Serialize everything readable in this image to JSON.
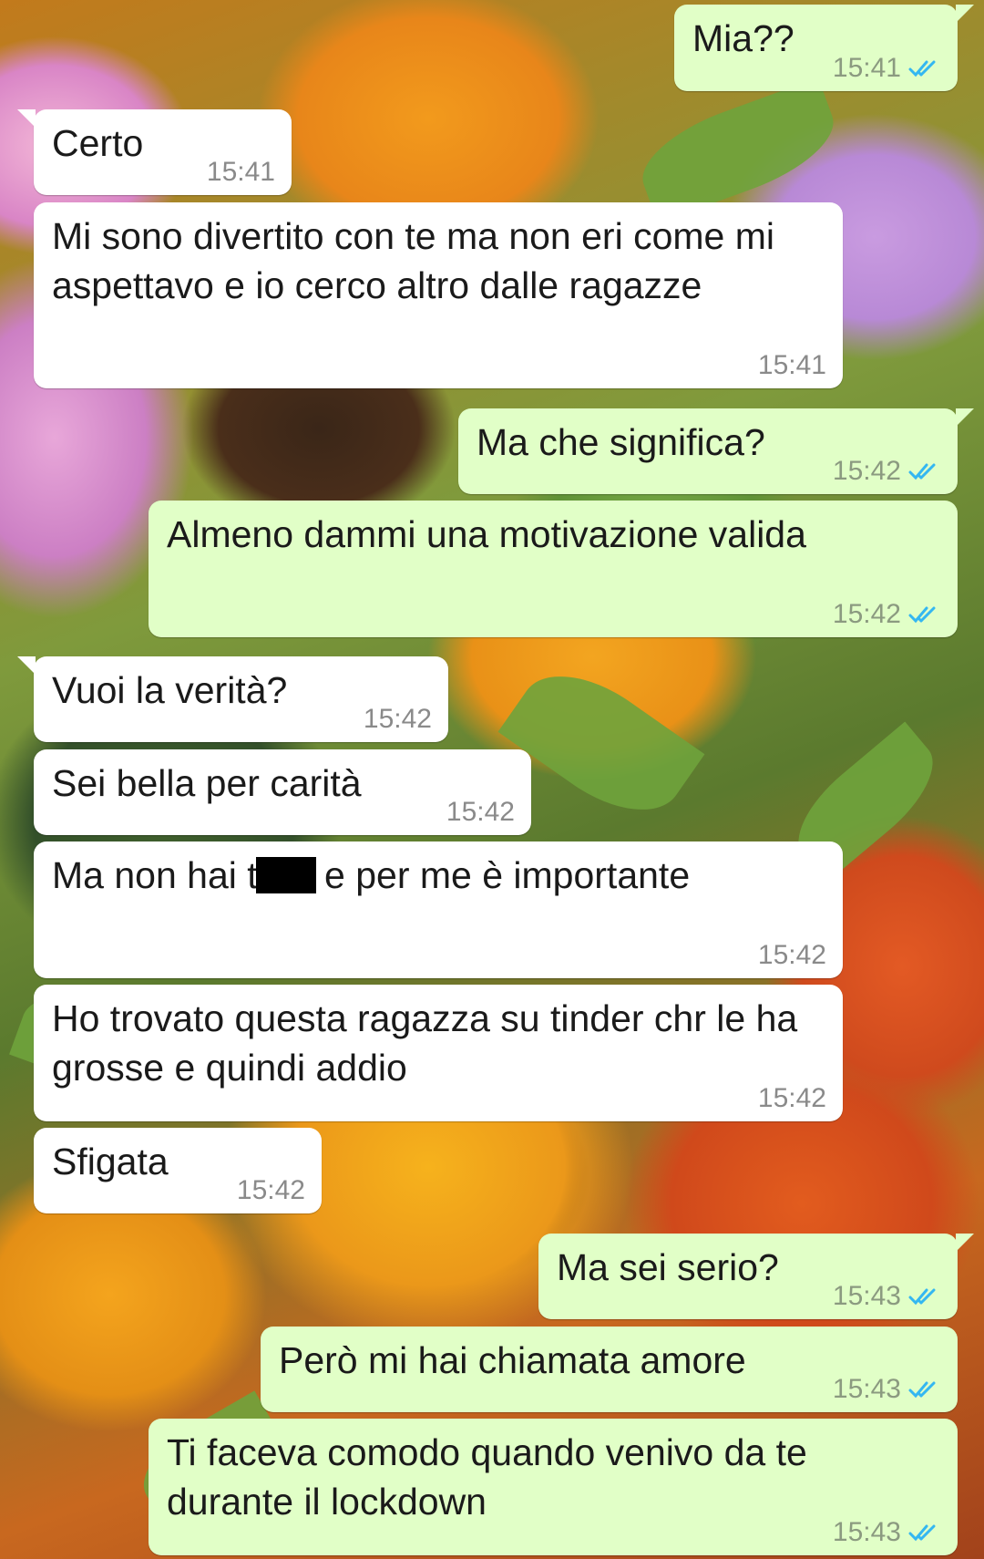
{
  "colors": {
    "incoming_bubble": "#ffffff",
    "outgoing_bubble": "#e1ffc7",
    "read_ticks": "#34b7f1",
    "timestamp": "#8a8a8a"
  },
  "messages": [
    {
      "direction": "out",
      "text": "Mia??",
      "time": "15:41",
      "status": "read-ticks-icon"
    },
    {
      "direction": "in",
      "text": "Certo",
      "time": "15:41"
    },
    {
      "direction": "in",
      "text": "Mi sono divertito con te ma non eri come mi aspettavo e io cerco altro dalle ragazze",
      "time": "15:41"
    },
    {
      "direction": "out",
      "text": "Ma che significa?",
      "time": "15:42",
      "status": "read-ticks-icon"
    },
    {
      "direction": "out",
      "text": "Almeno dammi una motivazione valida",
      "time": "15:42",
      "status": "read-ticks-icon"
    },
    {
      "direction": "in",
      "text": "Vuoi la verità?",
      "time": "15:42"
    },
    {
      "direction": "in",
      "text": "Sei bella per carità",
      "time": "15:42"
    },
    {
      "direction": "in",
      "text_before": "Ma non hai t",
      "text_after": " e per me è importante",
      "time": "15:42",
      "redacted": true
    },
    {
      "direction": "in",
      "text": "Ho trovato questa ragazza su tinder chr le ha grosse e quindi addio",
      "time": "15:42"
    },
    {
      "direction": "in",
      "text": "Sfigata",
      "time": "15:42"
    },
    {
      "direction": "out",
      "text": "Ma sei serio?",
      "time": "15:43",
      "status": "read-ticks-icon"
    },
    {
      "direction": "out",
      "text": "Però mi hai chiamata amore",
      "time": "15:43",
      "status": "read-ticks-icon"
    },
    {
      "direction": "out",
      "text": "Ti faceva comodo quando venivo da te durante il lockdown",
      "time": "15:43",
      "status": "read-ticks-icon"
    }
  ]
}
